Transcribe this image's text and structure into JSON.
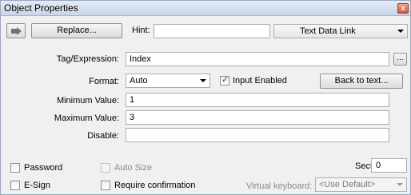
{
  "window": {
    "title": "Object Properties",
    "close_glyph": "x"
  },
  "toolbar": {
    "replace_label": "Replace...",
    "hint_label": "Hint:",
    "hint_value": "",
    "link_type": "Text Data Link"
  },
  "fields": {
    "tag_label": "Tag/Expression:",
    "tag_value": "Index",
    "browse_label": "...",
    "format_label": "Format:",
    "format_value": "Auto",
    "input_enabled_label": "Input Enabled",
    "input_enabled_checked": true,
    "back_to_text_label": "Back to text...",
    "min_label": "Minimum Value:",
    "min_value": "1",
    "max_label": "Maximum Value:",
    "max_value": "3",
    "disable_label": "Disable:",
    "disable_value": ""
  },
  "options": {
    "password_label": "Password",
    "auto_size_label": "Auto Size",
    "security_label": "Security:",
    "security_value": "0",
    "esign_label": "E-Sign",
    "require_confirmation_label": "Require confirmation",
    "virtual_keyboard_label": "Virtual keyboard:",
    "virtual_keyboard_value": "<Use Default>"
  }
}
